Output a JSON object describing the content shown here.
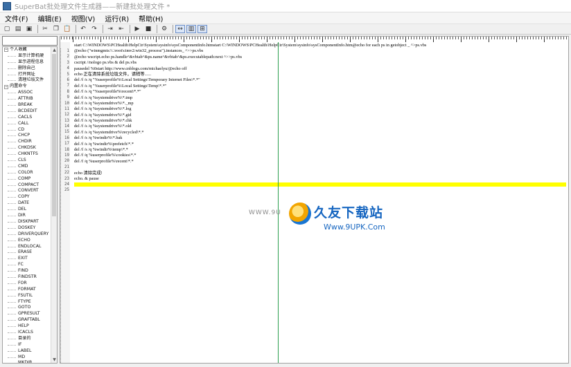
{
  "window": {
    "title": "SuperBat批处理文件生成器——新建批处理文件 *"
  },
  "menu": [
    {
      "label": "文件(F)"
    },
    {
      "label": "编辑(E)"
    },
    {
      "label": "视图(V)"
    },
    {
      "label": "运行(R)"
    },
    {
      "label": "帮助(H)"
    }
  ],
  "toolbar": {
    "buttons": [
      {
        "icon": "new-file-icon",
        "glyph": "▢"
      },
      {
        "icon": "open-folder-icon",
        "glyph": "▤"
      },
      {
        "icon": "save-icon",
        "glyph": "▣"
      },
      {
        "icon": "cut-icon",
        "glyph": "✂"
      },
      {
        "icon": "copy-icon",
        "glyph": "❐"
      },
      {
        "icon": "paste-icon",
        "glyph": "📋"
      },
      {
        "icon": "undo-icon",
        "glyph": "↶"
      },
      {
        "icon": "redo-icon",
        "glyph": "↷"
      },
      {
        "icon": "indent-icon",
        "glyph": "⇥"
      },
      {
        "icon": "outdent-icon",
        "glyph": "⇤"
      },
      {
        "icon": "run-icon",
        "glyph": "▶"
      },
      {
        "icon": "stop-icon",
        "glyph": "■"
      },
      {
        "icon": "build-icon",
        "glyph": "⚙"
      },
      {
        "icon": "view-split-icon",
        "glyph": "↔"
      },
      {
        "icon": "view-panel-icon",
        "glyph": "▥"
      },
      {
        "icon": "view-tree-icon",
        "glyph": "⊞"
      }
    ]
  },
  "tree": {
    "groups": [
      {
        "label": "个人收藏",
        "expander": "−",
        "items": [
          "显示计算机硬",
          "显示进程信息",
          "删除自己",
          "打开网址",
          "清理垃圾文件"
        ]
      },
      {
        "label": "内置命令",
        "expander": "−",
        "items": [
          "ASSOC",
          "ATTRIB",
          "BREAK",
          "BCDEDIT",
          "CACLS",
          "CALL",
          "CD",
          "CHCP",
          "CHDIR",
          "CHKDSK",
          "CHKNTFS",
          "CLS",
          "CMD",
          "COLOR",
          "COMP",
          "COMPACT",
          "CONVERT",
          "COPY",
          "DATE",
          "DEL",
          "DIR",
          "DISKPART",
          "DOSKEY",
          "DRIVERQUERY",
          "ECHO",
          "ENDLOCAL",
          "ERASE",
          "EXIT",
          "FC",
          "FIND",
          "FINDSTR",
          "FOR",
          "FORMAT",
          "FSUTIL",
          "FTYPE",
          "GOTO",
          "GPRESULT",
          "GRAFTABL",
          "HELP",
          "ICACLS",
          "目录的",
          "IF",
          "LABEL",
          "MD",
          "MKDIR"
        ]
      }
    ]
  },
  "editor": {
    "lines": [
      {
        "n": "1",
        "text": "start C:\\WINDOWS\\PCHealth\\HelpCtr\\System\\sysinfo\\sysComponentInfo.htmstart C:\\WINDOWS\\PCHealth\\HelpCtr\\System\\sysinfo\\sysComponentInfo.htm@echo for each ps in getobject _ ^>ps.vbs"
      },
      {
        "n": "2",
        "text": "@echo (\"winmgmts:\\\\.\\root\\cimv2:win32_process\").instances_ ^>>ps.vbs"
      },
      {
        "n": "3",
        "text": "@echo wscript.echo ps.handle^&vbtab^&ps.name^&vbtab^&ps.executablepath:next ^>>ps.vbs"
      },
      {
        "n": "4",
        "text": "cscript //nologo ps.vbs & del ps.vbs"
      },
      {
        "n": "5",
        "text": "pausedel %0start http://www.cnblogs.com/michaelyu/@echo off"
      },
      {
        "n": "6",
        "text": "echo 正在清除系统垃圾文件，请稍等......"
      },
      {
        "n": "7",
        "text": "del /f /s /q \"%userprofile%\\Local Settings\\Temporary Internet Files\\*.*\""
      },
      {
        "n": "8",
        "text": "del /f /s /q \"%userprofile%\\Local Settings\\Temp\\*.*\""
      },
      {
        "n": "9",
        "text": "del /f /s /q \"%userprofile%\\recent\\*.*\""
      },
      {
        "n": "10",
        "text": "del /f /s /q %systemdrive%\\*.tmp"
      },
      {
        "n": "11",
        "text": "del /f /s /q %systemdrive%\\*._mp"
      },
      {
        "n": "12",
        "text": "del /f /s /q %systemdrive%\\*.log"
      },
      {
        "n": "13",
        "text": "del /f /s /q %systemdrive%\\*.gid"
      },
      {
        "n": "14",
        "text": "del /f /s /q %systemdrive%\\*.chk"
      },
      {
        "n": "15",
        "text": "del /f /s /q %systemdrive%\\*.old"
      },
      {
        "n": "16",
        "text": "del /f /s /q %systemdrive%\\recycled\\*.*"
      },
      {
        "n": "17",
        "text": "del /f /s /q %windir%\\*.bak"
      },
      {
        "n": "18",
        "text": "del /f /s /q %windir%\\prefetch\\*.*"
      },
      {
        "n": "19",
        "text": "del /f /s /q %windir%\\temp\\*.*"
      },
      {
        "n": "20",
        "text": "del /f /q %userprofile%\\cookies\\*.*"
      },
      {
        "n": "21",
        "text": "del /f /q %userprofile%\\recent\\*.*"
      },
      {
        "n": "22",
        "text": ""
      },
      {
        "n": "23",
        "text": "echo 清除完成!"
      },
      {
        "n": "24",
        "text": "echo. & pause"
      },
      {
        "n": "25",
        "text": "",
        "highlight": true
      }
    ]
  },
  "watermark": {
    "faint_text": "WWW.9U",
    "title": "久友下载站",
    "url": "Www.9UPK.Com"
  },
  "colors": {
    "accent_green": "#2d9e4f",
    "highlight_yellow": "#ffff00",
    "watermark_blue": "#1565c0"
  }
}
